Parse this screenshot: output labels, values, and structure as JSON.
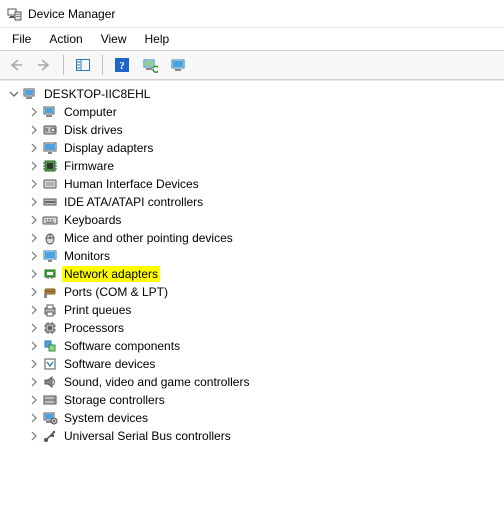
{
  "window": {
    "title": "Device Manager"
  },
  "menu": {
    "file": "File",
    "action": "Action",
    "view": "View",
    "help": "Help"
  },
  "toolbar": {
    "back": "Back",
    "forward": "Forward",
    "show_hide": "Show/Hide Console Tree",
    "help": "Help",
    "scan": "Scan for hardware changes",
    "add_legacy": "Add legacy hardware"
  },
  "tree": {
    "root": {
      "label": "DESKTOP-IIC8EHL",
      "expanded": true
    },
    "children": [
      {
        "label": "Computer",
        "icon": "computer",
        "highlight": false
      },
      {
        "label": "Disk drives",
        "icon": "disk",
        "highlight": false
      },
      {
        "label": "Display adapters",
        "icon": "display",
        "highlight": false
      },
      {
        "label": "Firmware",
        "icon": "firmware",
        "highlight": false
      },
      {
        "label": "Human Interface Devices",
        "icon": "hid",
        "highlight": false
      },
      {
        "label": "IDE ATA/ATAPI controllers",
        "icon": "ide",
        "highlight": false
      },
      {
        "label": "Keyboards",
        "icon": "keyboard",
        "highlight": false
      },
      {
        "label": "Mice and other pointing devices",
        "icon": "mouse",
        "highlight": false
      },
      {
        "label": "Monitors",
        "icon": "monitor",
        "highlight": false
      },
      {
        "label": "Network adapters",
        "icon": "network",
        "highlight": true
      },
      {
        "label": "Ports (COM & LPT)",
        "icon": "ports",
        "highlight": false
      },
      {
        "label": "Print queues",
        "icon": "printer",
        "highlight": false
      },
      {
        "label": "Processors",
        "icon": "cpu",
        "highlight": false
      },
      {
        "label": "Software components",
        "icon": "swcomp",
        "highlight": false
      },
      {
        "label": "Software devices",
        "icon": "swdev",
        "highlight": false
      },
      {
        "label": "Sound, video and game controllers",
        "icon": "sound",
        "highlight": false
      },
      {
        "label": "Storage controllers",
        "icon": "storage",
        "highlight": false
      },
      {
        "label": "System devices",
        "icon": "system",
        "highlight": false
      },
      {
        "label": "Universal Serial Bus controllers",
        "icon": "usb",
        "highlight": false
      }
    ]
  }
}
